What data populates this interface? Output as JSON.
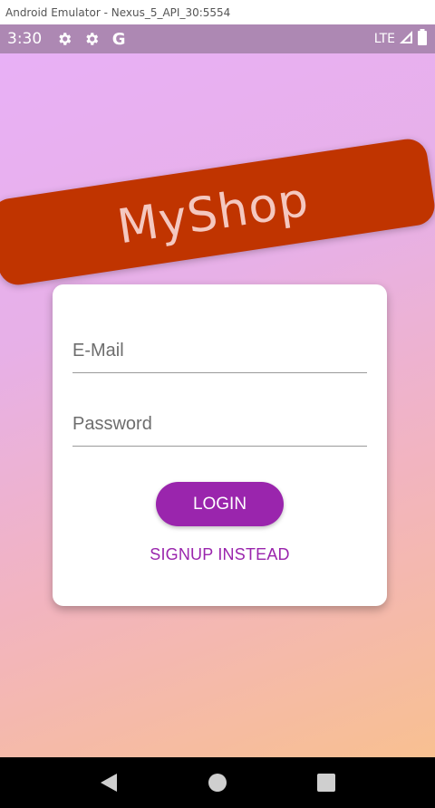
{
  "emulator": {
    "title": "Android Emulator - Nexus_5_API_30:5554"
  },
  "statusbar": {
    "time": "3:30",
    "icons": [
      "settings-icon",
      "settings-icon",
      "google-icon"
    ],
    "google_glyph": "G",
    "network": "LTE",
    "right_icons": [
      "signal-icon",
      "battery-icon"
    ]
  },
  "app": {
    "logo": "MyShop",
    "email_placeholder": "E-Mail",
    "password_placeholder": "Password",
    "login_label": "LOGIN",
    "signup_label": "SIGNUP INSTEAD"
  },
  "colors": {
    "accent": "#9a25ad",
    "banner": "#c03400",
    "gradient_start": "#e8b0f6",
    "gradient_end": "#f8c091",
    "statusbar": "#ad88b3"
  },
  "navbar": {
    "buttons": [
      "back-icon",
      "home-icon",
      "recents-icon"
    ]
  }
}
